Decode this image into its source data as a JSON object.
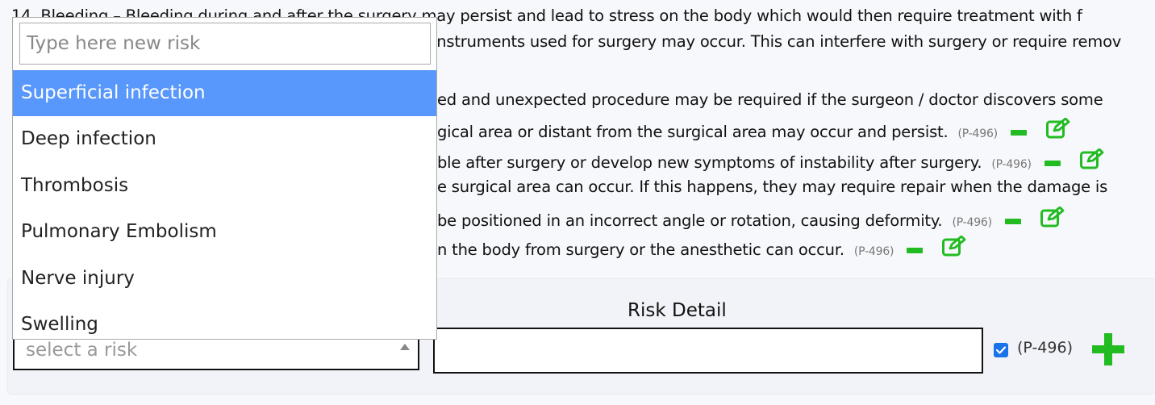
{
  "background_lines": [
    {
      "text": "14. Bleeding – Bleeding during and after the surgery may persist and lead to stress on the body which would then require treatment with f",
      "ref": "",
      "actions": false
    },
    {
      "text": "instruments used for surgery may occur. This can interfere with surgery or require remov",
      "ref": "",
      "actions": false
    },
    {
      "text": "ed and unexpected procedure may be required if the surgeon / doctor discovers some",
      "ref": "",
      "actions": false
    },
    {
      "text": "gical area or distant from the surgical area may occur and persist.",
      "ref": "(P-496)",
      "actions": true
    },
    {
      "text": "ble after surgery or develop new symptoms of instability after surgery.",
      "ref": "(P-496)",
      "actions": true
    },
    {
      "text": "e surgical area can occur. If this happens, they may require repair when the damage is",
      "ref": "",
      "actions": false
    },
    {
      "text": "be positioned in an incorrect angle or rotation, causing deformity.",
      "ref": "(P-496)",
      "actions": true
    },
    {
      "text": "n the body from surgery or the anesthetic can occur.",
      "ref": "(P-496)",
      "actions": true
    }
  ],
  "dropdown": {
    "search_placeholder": "Type here new risk",
    "options": [
      {
        "label": "Superficial infection",
        "selected": true
      },
      {
        "label": "Deep infection",
        "selected": false
      },
      {
        "label": "Thrombosis",
        "selected": false
      },
      {
        "label": "Pulmonary Embolism",
        "selected": false
      },
      {
        "label": "Nerve injury",
        "selected": false
      },
      {
        "label": "Swelling",
        "selected": false
      }
    ]
  },
  "form": {
    "risk_detail_label": "Risk Detail",
    "select_placeholder": "select a risk",
    "detail_value": "",
    "ref_label": "(P-496)",
    "checkbox_checked": true
  },
  "colors": {
    "accent_green": "#22bb22",
    "selected_option": "#5897fb",
    "checkbox_blue": "#1a73e8"
  },
  "icons": {
    "remove": "minus-icon",
    "edit": "edit-icon",
    "add": "plus-icon",
    "dropdown_arrow": "caret-up-icon"
  }
}
